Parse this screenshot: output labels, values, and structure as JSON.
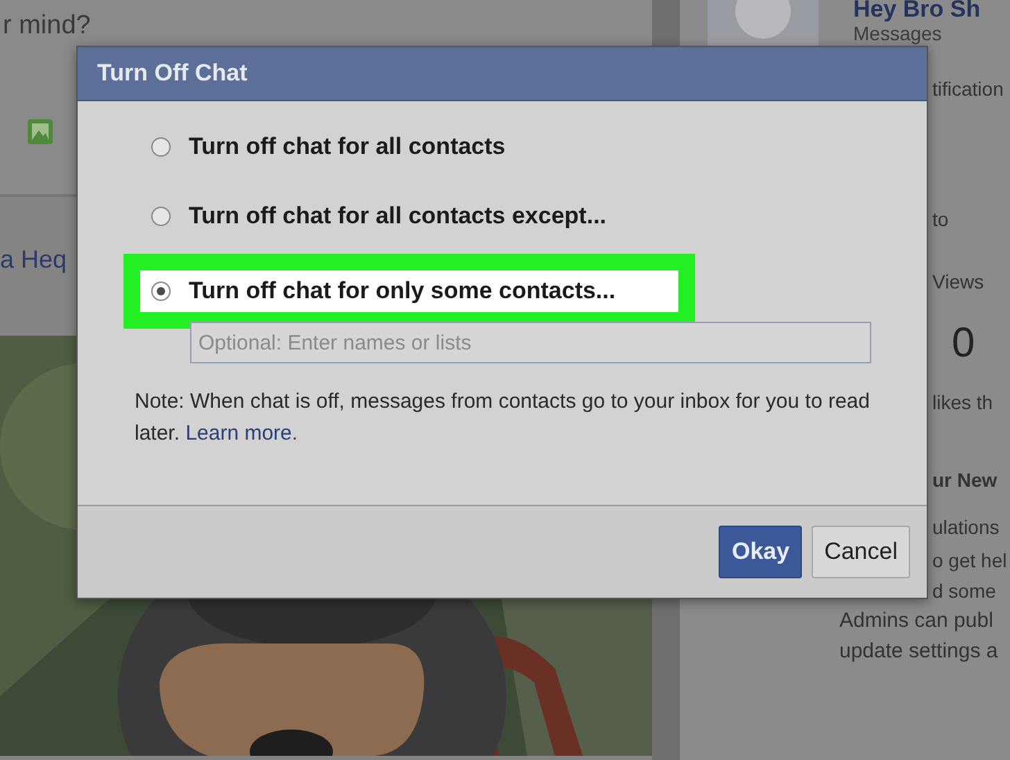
{
  "background": {
    "left": {
      "composer_hint": "r mind?",
      "link": "a Heq"
    },
    "right": {
      "page_name": "Hey Bro Sh",
      "lines": [
        {
          "kind": "meta",
          "text": "Messages"
        },
        {
          "kind": "fragment",
          "text": "tification"
        },
        {
          "kind": "fragment",
          "text": "to"
        },
        {
          "kind": "fragment",
          "text": "Views"
        },
        {
          "kind": "big",
          "text": "0"
        },
        {
          "kind": "fragment",
          "text": "likes th"
        },
        {
          "kind": "heading",
          "text": "ur New"
        },
        {
          "kind": "fragment",
          "text": "ulations"
        },
        {
          "kind": "fragment",
          "text": "o get hel"
        },
        {
          "kind": "fragment",
          "text": "d some"
        },
        {
          "kind": "line",
          "text": "Admins can publ"
        },
        {
          "kind": "line",
          "text": "update settings a"
        }
      ]
    }
  },
  "dialog": {
    "title": "Turn Off Chat",
    "options": [
      {
        "label": "Turn off chat for all contacts",
        "selected": false,
        "highlighted": false
      },
      {
        "label": "Turn off chat for all contacts except...",
        "selected": false,
        "highlighted": false
      },
      {
        "label": "Turn off chat for only some contacts...",
        "selected": true,
        "highlighted": true
      }
    ],
    "names_field": {
      "placeholder": "Optional: Enter names or lists"
    },
    "note": "Note: When chat is off, messages from contacts go to your inbox for you to read later.",
    "note_link": "Learn more.",
    "buttons": [
      {
        "label": "Okay",
        "kind": "primary"
      },
      {
        "label": "Cancel",
        "kind": "secondary"
      }
    ]
  }
}
